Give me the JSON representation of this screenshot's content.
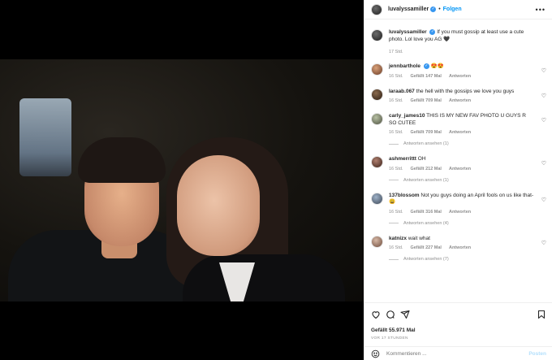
{
  "post": {
    "username": "luvalyssamiller",
    "follow_label": "Folgen",
    "more_label": "•••",
    "separator": "•"
  },
  "caption": {
    "username": "luvalyssamiller",
    "text": "If you must gossip at least use a cute photo. Lol love you AG 🖤",
    "time": "17 Std."
  },
  "comments": [
    {
      "username": "jennbarthole",
      "verified": true,
      "text": "😍😍",
      "time": "16 Std.",
      "likes": "Gefällt 147 Mal",
      "reply": "Antworten",
      "view_replies": ""
    },
    {
      "username": "laraab.067",
      "verified": false,
      "text": "the hell with the gossips we love you guys",
      "time": "16 Std.",
      "likes": "Gefällt 709 Mal",
      "reply": "Antworten",
      "view_replies": ""
    },
    {
      "username": "carly_james10",
      "verified": false,
      "text": "THIS IS MY NEW FAV PHOTO U GUYS R SO CUTEE",
      "time": "16 Std.",
      "likes": "Gefällt 709 Mal",
      "reply": "Antworten",
      "view_replies": "Antworten ansehen (1)"
    },
    {
      "username": "ashmerrittt",
      "verified": false,
      "text": "OH",
      "time": "16 Std.",
      "likes": "Gefällt 212 Mal",
      "reply": "Antworten",
      "view_replies": "Antworten ansehen (1)"
    },
    {
      "username": "137blossom",
      "verified": false,
      "text": "Not you guys doing an April fools on us like that-😩",
      "time": "16 Std.",
      "likes": "Gefällt 316 Mal",
      "reply": "Antworten",
      "view_replies": "Antworten ansehen (4)"
    },
    {
      "username": "katnizx",
      "verified": false,
      "text": "wait what",
      "time": "16 Std.",
      "likes": "Gefällt 227 Mal",
      "reply": "Antworten",
      "view_replies": "Antworten ansehen (7)"
    }
  ],
  "footer": {
    "likes": "Gefällt 55.971 Mal",
    "time": "VOR 17 STUNDEN",
    "comment_placeholder": "Kommentieren ...",
    "post_label": "Posten"
  },
  "icons": {
    "heart": "heart-icon",
    "comment": "comment-icon",
    "share": "share-icon",
    "save": "bookmark-icon",
    "emoji": "emoji-icon"
  },
  "colors": {
    "accent": "#0095f6",
    "verified": "#3897f0",
    "muted": "#8e8e8e",
    "post_disabled": "#b2dffc"
  }
}
